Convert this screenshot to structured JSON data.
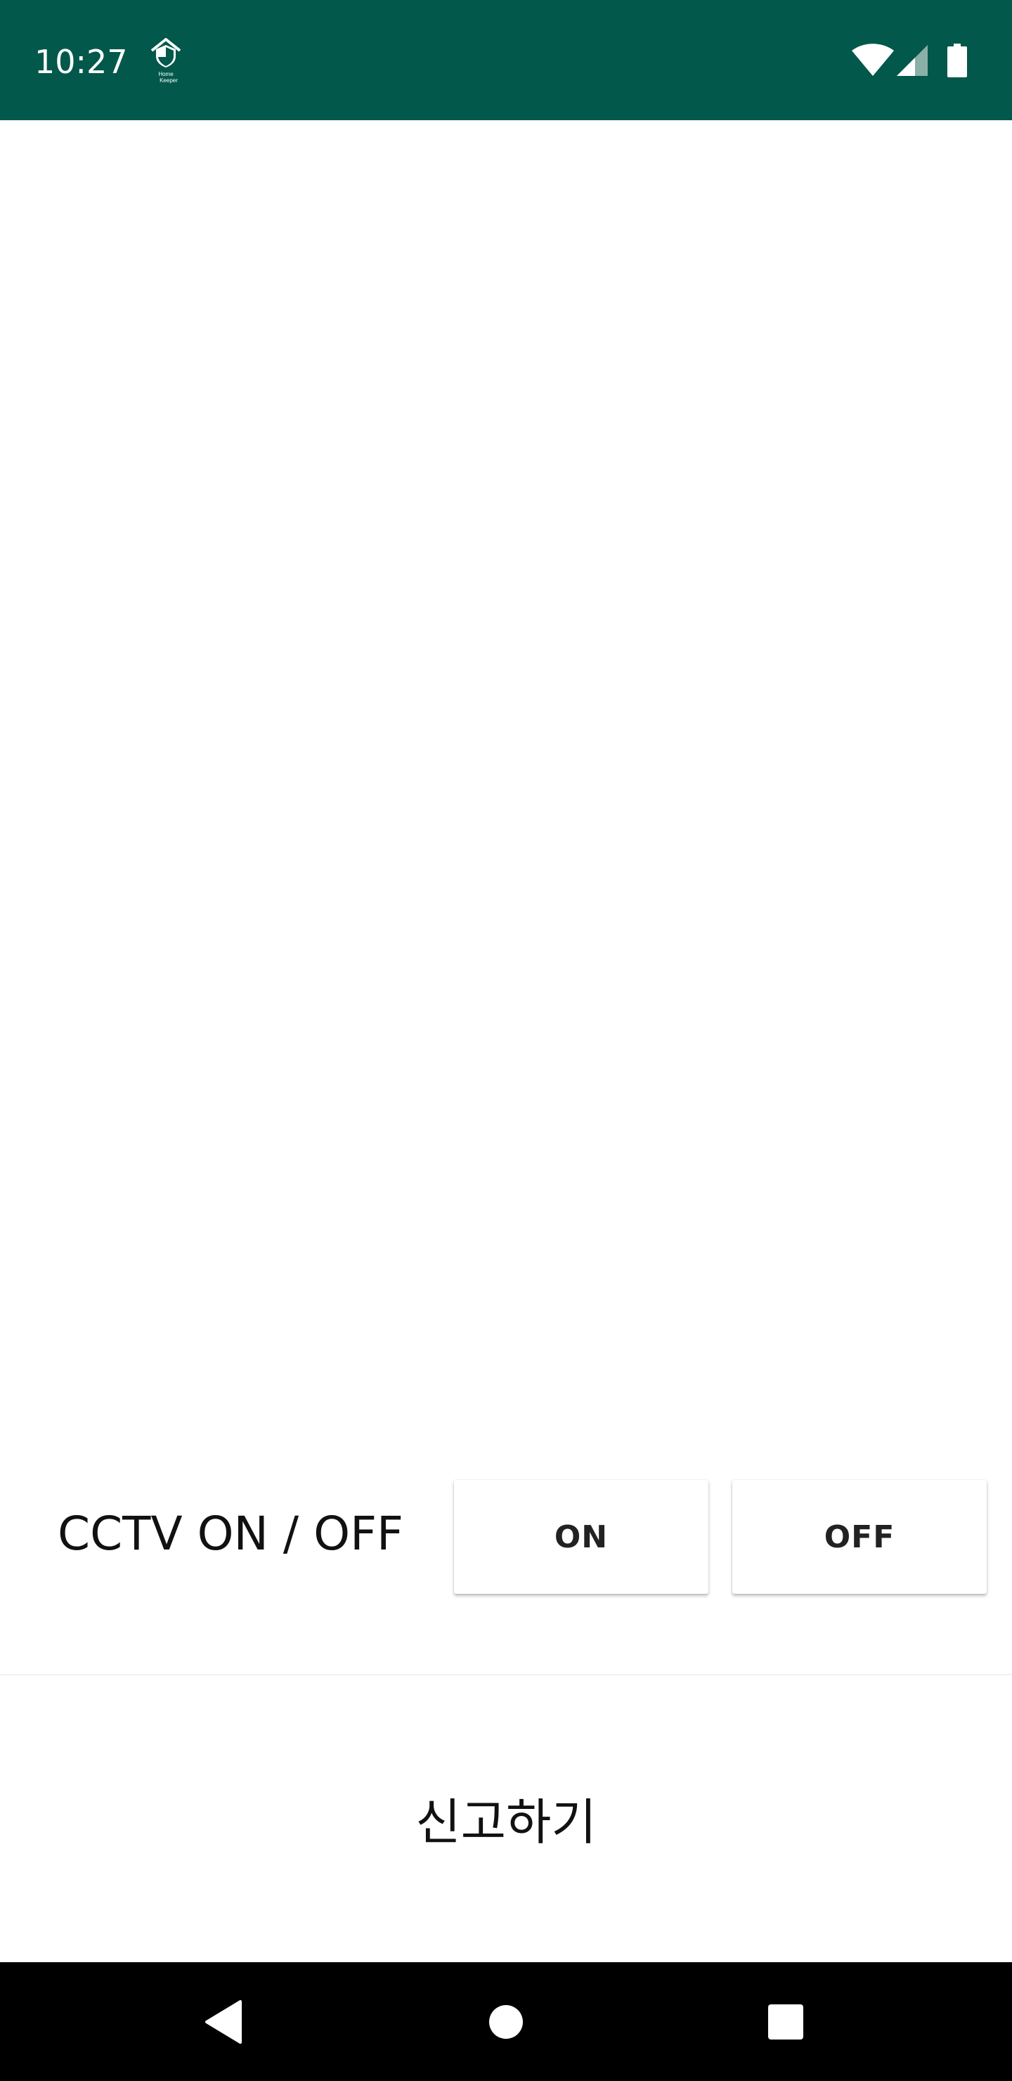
{
  "status_bar": {
    "time": "10:27",
    "app_icon": "home-keeper-shield-icon",
    "app_icon_text_line1": "Home",
    "app_icon_text_line2": "Keeper",
    "icons": [
      "wifi-icon",
      "cell-signal-icon",
      "battery-icon"
    ],
    "background_color": "#01584b"
  },
  "cctv": {
    "label": "CCTV ON / OFF",
    "on_button": "ON",
    "off_button": "OFF"
  },
  "report": {
    "label": "신고하기"
  },
  "nav_bar": {
    "icons": [
      "back-icon",
      "home-icon",
      "recents-icon"
    ]
  }
}
